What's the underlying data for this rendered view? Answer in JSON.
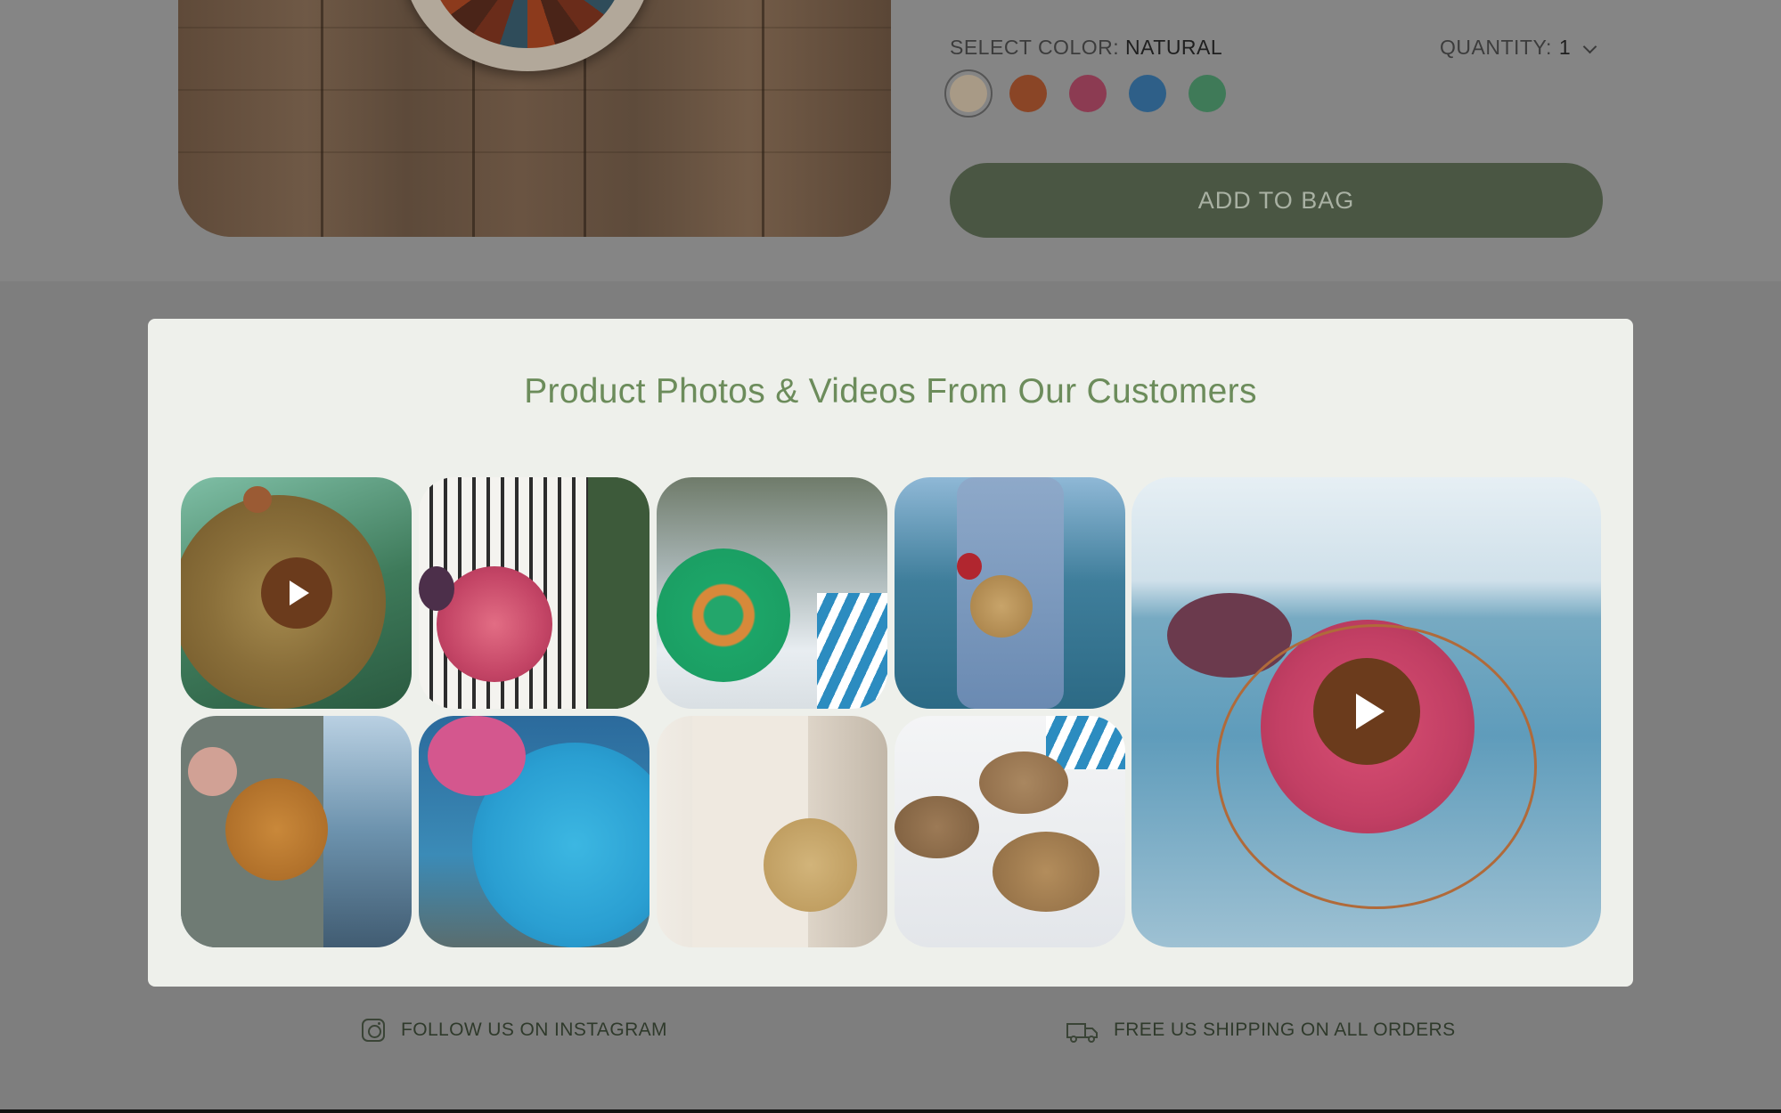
{
  "product": {
    "color_label": "SELECT COLOR:",
    "color_value": "NATURAL",
    "quantity_label": "QUANTITY:",
    "quantity_value": "1",
    "add_to_bag": "ADD TO BAG",
    "swatches": [
      {
        "name": "natural",
        "color": "#a89a86",
        "selected": true
      },
      {
        "name": "rust",
        "color": "#8a4526"
      },
      {
        "name": "pink",
        "color": "#8c3b52"
      },
      {
        "name": "blue",
        "color": "#2e5f88"
      },
      {
        "name": "green",
        "color": "#3f7a58"
      }
    ]
  },
  "gallery": {
    "title": "Product Photos & Videos From Our Customers",
    "items": [
      {
        "name": "customer-photo-1",
        "video": true
      },
      {
        "name": "customer-photo-2",
        "video": false
      },
      {
        "name": "customer-photo-3",
        "video": false
      },
      {
        "name": "customer-photo-4",
        "video": false
      },
      {
        "name": "customer-photo-5",
        "video": false
      },
      {
        "name": "customer-photo-6",
        "video": false
      },
      {
        "name": "customer-photo-7",
        "video": false
      },
      {
        "name": "customer-photo-8",
        "video": false
      },
      {
        "name": "customer-photo-featured",
        "video": true
      }
    ]
  },
  "footer": {
    "instagram": "FOLLOW US ON INSTAGRAM",
    "shipping": "FREE US SHIPPING ON ALL ORDERS"
  },
  "colors": {
    "accent": "#6c8c5b",
    "button": "#4a5643",
    "play": "#6b3b1c"
  }
}
